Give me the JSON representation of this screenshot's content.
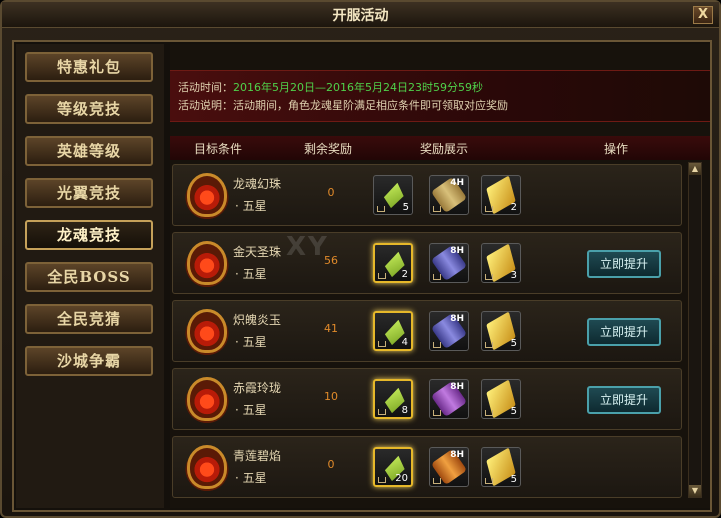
{
  "window": {
    "title": "开服活动",
    "close_label": "X"
  },
  "sidebar": {
    "items": [
      {
        "label": "特惠礼包",
        "active": false
      },
      {
        "label": "等级竞技",
        "active": false
      },
      {
        "label": "英雄等级",
        "active": false
      },
      {
        "label": "光翼竞技",
        "active": false
      },
      {
        "label": "龙魂竞技",
        "active": true
      },
      {
        "label": "全民BOSS",
        "active": false
      },
      {
        "label": "全民竞猜",
        "active": false
      },
      {
        "label": "沙城争霸",
        "active": false
      }
    ]
  },
  "banner": {
    "time_label": "活动时间：",
    "time_value": "2016年5月20日—2016年5月24日23时59分59秒",
    "desc_label": "活动说明：",
    "desc_value": "活动期间，角色龙魂星阶满足相应条件即可领取对应奖励"
  },
  "headers": {
    "target": "目标条件",
    "remain": "剩余奖励",
    "display": "奖励展示",
    "action": "操作"
  },
  "watermark": "XY",
  "rows": [
    {
      "name": "龙魂幻珠",
      "star": "· 五星",
      "remain": "0",
      "rewards": [
        {
          "icon": "crystal-icon",
          "count": "5",
          "glow": false
        },
        {
          "icon": "scroll-icon",
          "hours": "4H",
          "count": "",
          "glow": false
        },
        {
          "icon": "gold-ingot-icon",
          "count": "2",
          "glow": false
        }
      ],
      "button": ""
    },
    {
      "name": "金天圣珠",
      "star": "· 五星",
      "remain": "56",
      "rewards": [
        {
          "icon": "crystal-icon",
          "count": "2",
          "glow": true
        },
        {
          "icon": "scroll-icon",
          "hours": "8H",
          "count": "",
          "glow": false
        },
        {
          "icon": "gold-ingot-icon",
          "count": "3",
          "glow": false
        }
      ],
      "button": "立即提升"
    },
    {
      "name": "炽魄炎玉",
      "star": "· 五星",
      "remain": "41",
      "rewards": [
        {
          "icon": "crystal-icon",
          "count": "4",
          "glow": true
        },
        {
          "icon": "scroll-icon",
          "hours": "8H",
          "count": "",
          "glow": false
        },
        {
          "icon": "gold-ingot-icon",
          "count": "5",
          "glow": false
        }
      ],
      "button": "立即提升"
    },
    {
      "name": "赤霞玲珑",
      "star": "· 五星",
      "remain": "10",
      "rewards": [
        {
          "icon": "crystal-icon",
          "count": "8",
          "glow": true
        },
        {
          "icon": "scroll-icon",
          "hours": "8H",
          "count": "",
          "glow": false
        },
        {
          "icon": "gold-ingot-icon",
          "count": "5",
          "glow": false
        }
      ],
      "button": "立即提升"
    },
    {
      "name": "青莲碧焰",
      "star": "· 五星",
      "remain": "0",
      "rewards": [
        {
          "icon": "crystal-icon",
          "count": "20",
          "glow": true
        },
        {
          "icon": "scroll-icon",
          "hours": "8H",
          "count": "",
          "glow": false
        },
        {
          "icon": "gold-ingot-icon",
          "count": "5",
          "glow": false
        }
      ],
      "button": ""
    }
  ]
}
